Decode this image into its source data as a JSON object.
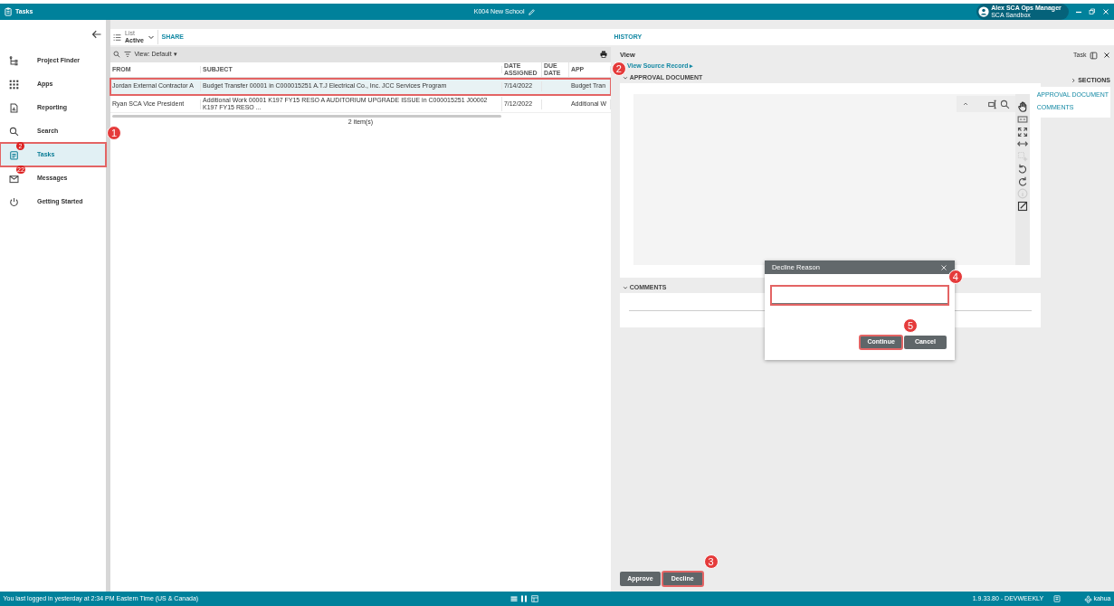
{
  "app_bar": {
    "title": "Tasks",
    "project": "K004 New School",
    "user_name": "Alex SCA Ops Manager",
    "user_org": "SCA Sandbox"
  },
  "sidebar": {
    "items": [
      {
        "label": "Project Finder",
        "selected": false,
        "highlighted": false
      },
      {
        "label": "Apps",
        "selected": false,
        "highlighted": false
      },
      {
        "label": "Reporting",
        "selected": false,
        "highlighted": false
      },
      {
        "label": "Search",
        "selected": false,
        "highlighted": false
      },
      {
        "label": "Tasks",
        "selected": true,
        "highlighted": true,
        "badge": "2",
        "callout": "1"
      },
      {
        "label": "Messages",
        "selected": false,
        "highlighted": false,
        "badge": "22"
      },
      {
        "label": "Getting Started",
        "selected": false,
        "highlighted": false
      }
    ]
  },
  "list_toolbar": {
    "caption": "List",
    "value": "Active",
    "share": "SHARE"
  },
  "table": {
    "view": "View: Default ▾",
    "columns": [
      "FROM",
      "SUBJECT",
      "DATE ASSIGNED",
      "DUE DATE",
      "APP"
    ],
    "rows": [
      {
        "from": "Jordan External Contractor A",
        "subject": "Budget Transfer 00001 in C000015251 A.T.J Electrical Co., Inc. JCC Services Program",
        "date_assigned": "7/14/2022",
        "app": "Budget Tran",
        "selected": true,
        "highlighted": true,
        "callout": "2"
      },
      {
        "from": "Ryan SCA Vice President",
        "subject": "Additional Work 00001 K197 FY15 RESO A AUDITORIUM UPGRADE ISSUE in C000015251 J00002 K197 FY15 RESO ...",
        "date_assigned": "7/12/2022",
        "app": "Additional W",
        "selected": false,
        "highlighted": false
      }
    ],
    "count": "2 item(s)"
  },
  "history_tab": "HISTORY",
  "view": {
    "title": "View",
    "task_label": "Task",
    "source_link": "View Source Record ▸",
    "sections": [
      {
        "title": "APPROVAL DOCUMENT",
        "expanded": true
      },
      {
        "title": "COMMENTS",
        "expanded": true
      }
    ],
    "sections_panel": {
      "title": "SECTIONS",
      "links": [
        "APPROVAL DOCUMENT",
        "COMMENTS"
      ]
    }
  },
  "actions": [
    {
      "label": "Approve",
      "highlighted": false
    },
    {
      "label": "Decline",
      "highlighted": true,
      "callout": "3"
    }
  ],
  "dialog": {
    "title": "Decline Reason",
    "field_highlighted": true,
    "field_callout": "4",
    "buttons": [
      {
        "label": "Continue",
        "highlighted": true,
        "callout": "5"
      },
      {
        "label": "Cancel",
        "highlighted": false
      }
    ]
  },
  "status_bar": {
    "message": "You last logged in yesterday at 2:34 PM Eastern Time (US & Canada)",
    "version": "1.9.33.80 - DEVWEEKLY",
    "brand": "kahua"
  }
}
